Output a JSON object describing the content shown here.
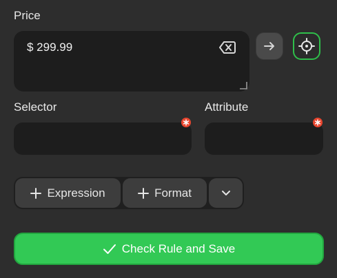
{
  "price": {
    "label": "Price",
    "value": "$ 299.99"
  },
  "selector": {
    "label": "Selector"
  },
  "attribute": {
    "label": "Attribute"
  },
  "toolbar": {
    "expression_label": "Expression",
    "format_label": "Format"
  },
  "save": {
    "label": "Check Rule and Save"
  },
  "colors": {
    "background": "#2d2d2d",
    "field": "#1d1d1d",
    "accent_green": "#32c955",
    "required_red": "#e8462f"
  },
  "icons": [
    "clear-icon",
    "arrow-right-icon",
    "crosshair-icon",
    "required-icon",
    "plus-icon",
    "chevron-down-icon",
    "check-icon",
    "resize-grip-icon"
  ]
}
